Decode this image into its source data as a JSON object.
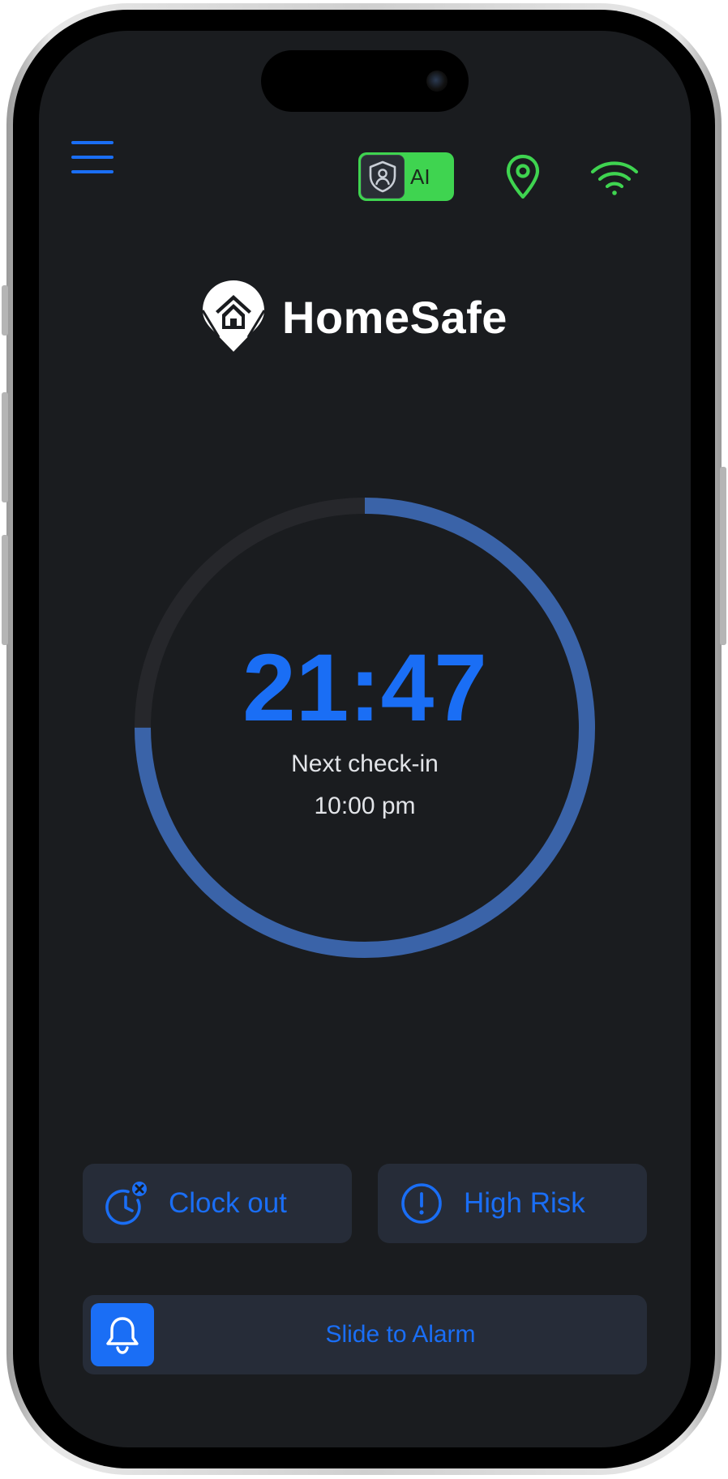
{
  "app": {
    "name": "HomeSafe"
  },
  "header": {
    "ai_toggle_label": "AI",
    "ai_enabled": true
  },
  "timer": {
    "value": "21:47",
    "caption": "Next check-in",
    "next_time": "10:00 pm",
    "progress_fraction": 0.75
  },
  "actions": {
    "clock_out_label": "Clock out",
    "high_risk_label": "High Risk"
  },
  "alarm_slider": {
    "label": "Slide to Alarm"
  },
  "icons": {
    "menu": "hamburger-menu-icon",
    "ai_shield": "shield-user-icon",
    "location": "map-pin-icon",
    "wifi": "wifi-icon",
    "clock_out": "clock-x-icon",
    "high_risk": "alert-circle-icon",
    "alarm": "bell-icon",
    "logo": "homesafe-logo-icon"
  },
  "colors": {
    "background": "#1a1c1f",
    "accent": "#1a6ef5",
    "status_green": "#3fd450",
    "ring_progress": "#3a63a8",
    "ring_track": "#26272b",
    "button_bg": "#262c38"
  }
}
